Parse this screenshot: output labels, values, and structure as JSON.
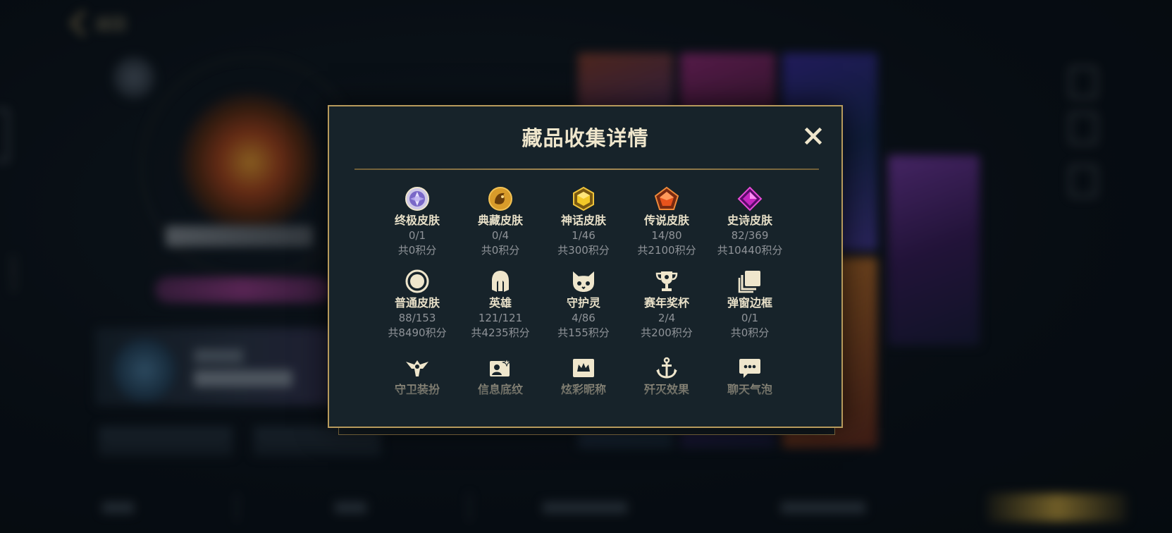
{
  "background": {
    "back_label": "返回",
    "side_id": "1103274",
    "bottom_tabs": [
      "",
      "",
      "",
      ""
    ]
  },
  "modal": {
    "title": "藏品收集详情",
    "close_icon": "close-icon",
    "colors": {
      "accent_gold": "#b79a5c",
      "panel_bg": "#17232a",
      "title_text": "#efe6cc",
      "muted_text": "#8f9398"
    },
    "items": [
      {
        "label": "终极皮肤",
        "count": "0/1",
        "points": "共0积分",
        "icon": "ultimate-skin-icon"
      },
      {
        "label": "典藏皮肤",
        "count": "0/4",
        "points": "共0积分",
        "icon": "prestige-skin-icon"
      },
      {
        "label": "神话皮肤",
        "count": "1/46",
        "points": "共300积分",
        "icon": "mythic-skin-icon"
      },
      {
        "label": "传说皮肤",
        "count": "14/80",
        "points": "共2100积分",
        "icon": "legendary-skin-icon"
      },
      {
        "label": "史诗皮肤",
        "count": "82/369",
        "points": "共10440积分",
        "icon": "epic-skin-icon"
      },
      {
        "label": "普通皮肤",
        "count": "88/153",
        "points": "共8490积分",
        "icon": "standard-skin-icon"
      },
      {
        "label": "英雄",
        "count": "121/121",
        "points": "共4235积分",
        "icon": "champion-helmet-icon"
      },
      {
        "label": "守护灵",
        "count": "4/86",
        "points": "共155积分",
        "icon": "guardian-spirit-icon"
      },
      {
        "label": "赛年奖杯",
        "count": "2/4",
        "points": "共200积分",
        "icon": "trophy-icon"
      },
      {
        "label": "弹窗边框",
        "count": "0/1",
        "points": "共0积分",
        "icon": "popup-frame-icon"
      },
      {
        "label": "守卫装扮",
        "icon": "ward-skin-icon"
      },
      {
        "label": "信息底纹",
        "icon": "profile-banner-icon"
      },
      {
        "label": "炫彩昵称",
        "icon": "color-nickname-icon"
      },
      {
        "label": "歼灭效果",
        "icon": "ace-effect-icon"
      },
      {
        "label": "聊天气泡",
        "icon": "chat-bubble-icon"
      }
    ]
  }
}
